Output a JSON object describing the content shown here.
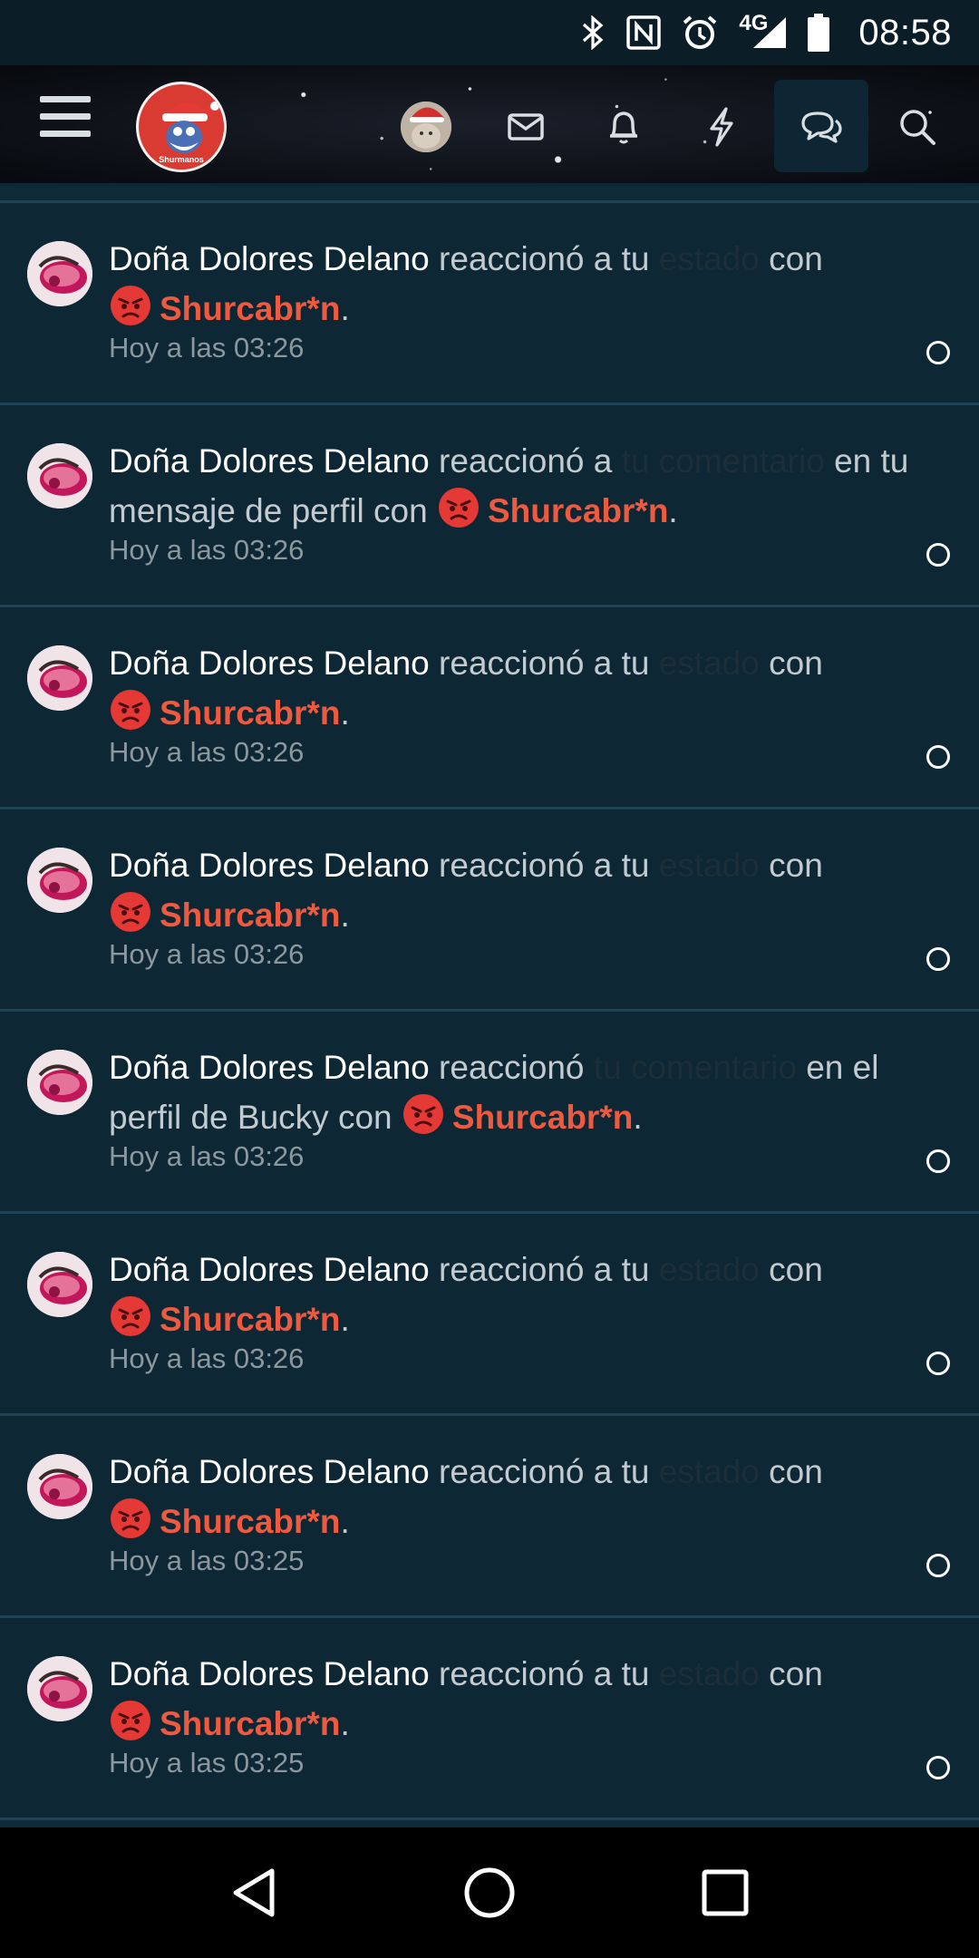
{
  "status_bar": {
    "time": "08:58",
    "network": "4G",
    "icons": [
      "bluetooth-icon",
      "nfc-icon",
      "alarm-icon",
      "signal-icon",
      "battery-icon"
    ]
  },
  "header": {
    "logo_text": "Shurmanos",
    "icons": [
      "menu-icon",
      "user-avatar",
      "mail-icon",
      "bell-icon",
      "bolt-icon",
      "conversations-icon",
      "search-icon"
    ]
  },
  "colors": {
    "background": "#0f2a38",
    "item_background": "#0d2734",
    "reaction": "#ee5a3f",
    "name": "#ffffff",
    "muted": "#8c979e"
  },
  "notifications": [
    {
      "name": "Doña Dolores Delano",
      "pre": " reaccionó a tu ",
      "link": "estado",
      "post": " con",
      "reaction": "Shurcabr*n",
      "end": ".",
      "time": "Hoy a las 03:26"
    },
    {
      "name": "Doña Dolores Delano",
      "pre": " reaccionó a ",
      "link": "tu comentario",
      "post": " en tu mensaje de perfil con",
      "reaction": "Shurcabr*n",
      "end": ".",
      "time": "Hoy a las 03:26"
    },
    {
      "name": "Doña Dolores Delano",
      "pre": " reaccionó a tu ",
      "link": "estado",
      "post": " con",
      "reaction": "Shurcabr*n",
      "end": ".",
      "time": "Hoy a las 03:26"
    },
    {
      "name": "Doña Dolores Delano",
      "pre": " reaccionó a tu ",
      "link": "estado",
      "post": " con",
      "reaction": "Shurcabr*n",
      "end": ".",
      "time": "Hoy a las 03:26"
    },
    {
      "name": "Doña Dolores Delano",
      "pre": " reaccionó ",
      "link": "tu comentario",
      "post": " en el perfil de Bucky con",
      "reaction": "Shurcabr*n",
      "end": ".",
      "time": "Hoy a las 03:26"
    },
    {
      "name": "Doña Dolores Delano",
      "pre": " reaccionó a tu ",
      "link": "estado",
      "post": " con",
      "reaction": "Shurcabr*n",
      "end": ".",
      "time": "Hoy a las 03:26"
    },
    {
      "name": "Doña Dolores Delano",
      "pre": " reaccionó a tu ",
      "link": "estado",
      "post": " con",
      "reaction": "Shurcabr*n",
      "end": ".",
      "time": "Hoy a las 03:25"
    },
    {
      "name": "Doña Dolores Delano",
      "pre": " reaccionó a tu ",
      "link": "estado",
      "post": " con",
      "reaction": "Shurcabr*n",
      "end": ".",
      "time": "Hoy a las 03:25"
    }
  ],
  "nav": [
    "back-icon",
    "home-icon",
    "recents-icon"
  ]
}
